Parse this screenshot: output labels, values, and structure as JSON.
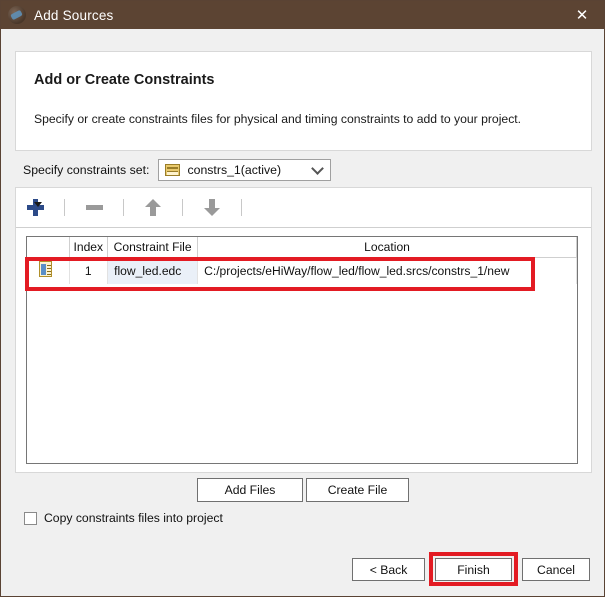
{
  "titlebar": {
    "title": "Add Sources",
    "icon": "app-logo-icon",
    "close_label": "✕"
  },
  "header": {
    "title": "Add or Create Constraints",
    "subtitle": "Specify or create constraints files for physical and timing constraints to add to your project."
  },
  "constraints_set": {
    "label": "Specify constraints set:",
    "selected": "constrs_1(active)",
    "icon": "folder-icon",
    "options": [
      "constrs_1(active)"
    ]
  },
  "toolbar": {
    "add_label": "",
    "remove_label": "",
    "move_up_label": "",
    "move_down_label": "",
    "icons": [
      "plus-icon",
      "minus-icon",
      "arrow-up-icon",
      "arrow-down-icon"
    ]
  },
  "table": {
    "columns": [
      "",
      "Index",
      "Constraint File",
      "Location"
    ],
    "rows": [
      {
        "icon": "constraint-file-icon",
        "index": "1",
        "file": "flow_led.edc",
        "location": "C:/projects/eHiWay/flow_led/flow_led.srcs/constrs_1/new"
      }
    ]
  },
  "actions": {
    "add_files": "Add Files",
    "create_file": "Create File"
  },
  "copy_option": {
    "label": "Copy constraints files into project",
    "checked": false
  },
  "footer": {
    "back": "< Back",
    "finish": "Finish",
    "cancel": "Cancel"
  },
  "colors": {
    "titlebar": "#5c4433",
    "annotation": "#e31b23",
    "accent_plus": "#2c4a88",
    "row_highlight": "#eaf0f8"
  }
}
